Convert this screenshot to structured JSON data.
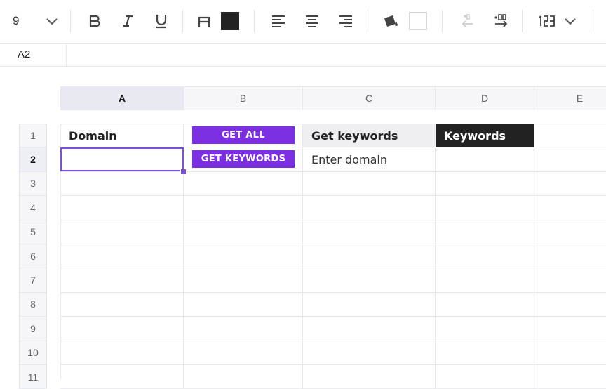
{
  "toolbar": {
    "font_size": "9",
    "text_color_hex": "#222222",
    "fill_color_hex": "#ffffff",
    "icons": [
      "chevron-down-icon",
      "bold-icon",
      "italic-icon",
      "underline-icon",
      "text-color-icon",
      "align-left-icon",
      "align-center-icon",
      "align-right-icon",
      "fill-color-icon",
      "decrease-decimal-icon",
      "increase-decimal-icon",
      "number-format-icon",
      "chevron-down-icon"
    ]
  },
  "formula": {
    "cell_ref": "A2",
    "value": ""
  },
  "columns": [
    "A",
    "B",
    "C",
    "D",
    "E"
  ],
  "rows": [
    "1",
    "2",
    "3",
    "4",
    "5",
    "6",
    "7",
    "8",
    "9",
    "10",
    "11"
  ],
  "active": {
    "column": "A",
    "row": "2"
  },
  "cells": {
    "a1": "Domain",
    "b1": "GET ALL",
    "c1": "Get keywords",
    "d1": "Keywords",
    "b2": "GET KEYWORDS",
    "c2": "Enter domain"
  },
  "colors": {
    "accent": "#7b2fe0",
    "selection": "#7b4fd8",
    "header_dark": "#222222",
    "header_light": "#eeeef3"
  }
}
